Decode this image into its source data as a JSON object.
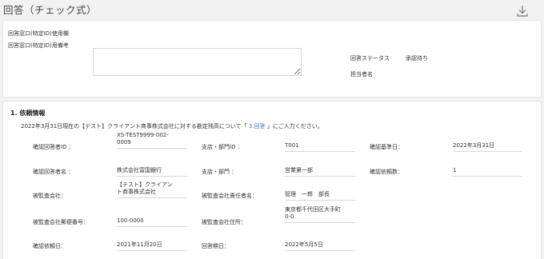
{
  "header": {
    "title": "回答（チェック式）"
  },
  "top_panel": {
    "usage_label": "回答窓口(特定ID)使用欄",
    "memo_label": "回答窓口(特定ID)用備考",
    "memo_value": "",
    "status_label": "回答ステータス",
    "status_value": "承認待ち",
    "assignee_label": "担当者名",
    "assignee_value": ""
  },
  "section1": {
    "title": "1. 依頼情報",
    "intro_prefix": "2022年3月31日現在の【テスト】クライアント商事株式会社に対する勘定残高について「",
    "intro_link": " 3.回答 ",
    "intro_suffix": "」にご入力ください。",
    "fields": {
      "confirmer_id_label": "確認回答者ID ：",
      "confirmer_id_value": "XS-TEST9999-002-\n0009",
      "branch_id_label": "支店・部門ID ：",
      "branch_id_value": "T001",
      "base_date_label": "確認基準日：",
      "base_date_value": "2022年3月31日",
      "confirmer_name_label": "確認回答者名 ：",
      "confirmer_name_value": "株式会社富国銀行",
      "branch_label": "支店・部門 ：",
      "branch_value": "営業第一部",
      "request_count_label": "確認依頼数：",
      "request_count_value": "1",
      "audited_company_label": "被監査会社：",
      "audited_company_value": "【テスト】クライアン\nト商事株式会社",
      "audited_manager_label": "被監査会社責任者名：",
      "audited_manager_value": "管理　一郎　部長",
      "postal_label": "被監査会社郵便番号：",
      "postal_value": "100-0000",
      "address_label": "被監査会社住所：",
      "address_value": "東京都千代田区大手町\n0-0",
      "request_date_label": "確認依頼日：",
      "request_date_value": "2021年11月20日",
      "due_date_label": "回答期日：",
      "due_date_value": "2022年5月5日"
    }
  }
}
